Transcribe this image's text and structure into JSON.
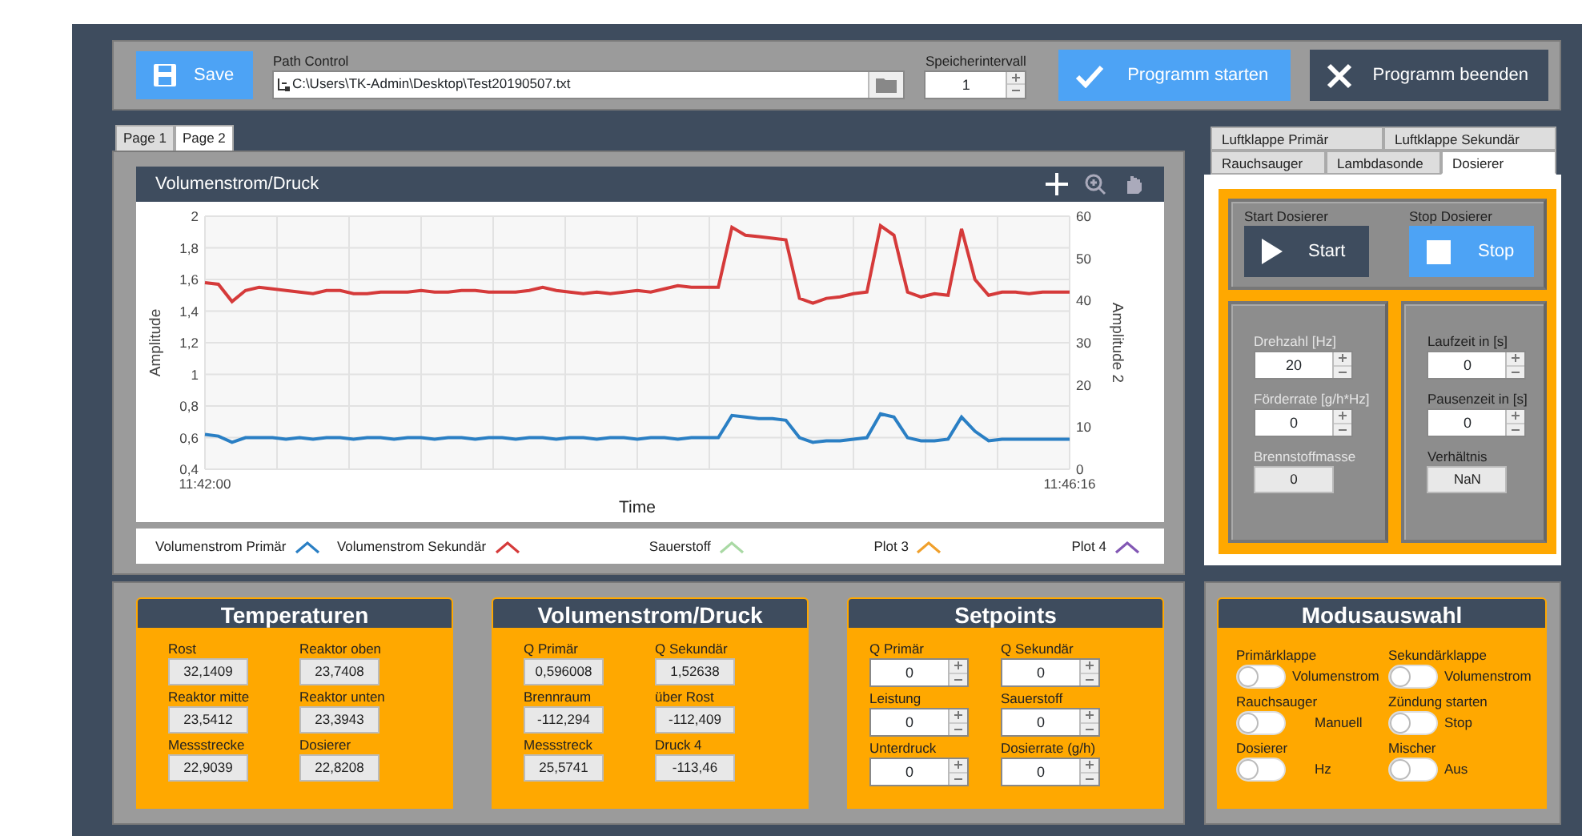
{
  "toolbar": {
    "save_button": "Save",
    "path_label": "Path Control",
    "path_value": "C:\\Users\\TK-Admin\\Desktop\\Test20190507.txt",
    "interval_label": "Speicherintervall",
    "interval_value": "1",
    "start_button": "Programm starten",
    "stop_button": "Programm beenden"
  },
  "page_tabs": [
    {
      "label": "Page 1",
      "selected": false
    },
    {
      "label": "Page 2",
      "selected": true
    }
  ],
  "chart": {
    "title": "Volumenstrom/Druck",
    "chart_data": {
      "type": "line",
      "grid": true,
      "xlabel": "Time",
      "ylabel": "Amplitude",
      "y2label": "Amplitude 2",
      "ylim": [
        0.4,
        2
      ],
      "y2lim": [
        0,
        60
      ],
      "yticks": [
        {
          "value": 0.4,
          "label": "0,4"
        },
        {
          "value": 0.6,
          "label": "0,6"
        },
        {
          "value": 0.8,
          "label": "0,8"
        },
        {
          "value": 1,
          "label": "1"
        },
        {
          "value": 1.2,
          "label": "1,2"
        },
        {
          "value": 1.4,
          "label": "1,4"
        },
        {
          "value": 1.6,
          "label": "1,6"
        },
        {
          "value": 1.8,
          "label": "1,8"
        },
        {
          "value": 2,
          "label": "2"
        }
      ],
      "y2ticks": [
        0,
        10,
        20,
        30,
        40,
        50,
        60
      ],
      "categories": [
        "11:42:00",
        null,
        null,
        null,
        null,
        null,
        null,
        null,
        null,
        null,
        null,
        null,
        null,
        null,
        null,
        null,
        null,
        null,
        null,
        null,
        null,
        null,
        null,
        null,
        null,
        null,
        null,
        null,
        null,
        null,
        null,
        null,
        null,
        null,
        null,
        null,
        null,
        null,
        null,
        null,
        null,
        null,
        null,
        null,
        null,
        null,
        null,
        null,
        null,
        null,
        null,
        null,
        null,
        null,
        null,
        null,
        null,
        null,
        null,
        null,
        null,
        null,
        null,
        null,
        "11:46:16"
      ],
      "series": [
        {
          "name": "Volumenstrom Primär",
          "color": "#2a7fc4",
          "values": [
            0.62,
            0.61,
            0.57,
            0.6,
            0.6,
            0.6,
            0.59,
            0.6,
            0.59,
            0.6,
            0.6,
            0.59,
            0.6,
            0.6,
            0.59,
            0.6,
            0.6,
            0.59,
            0.6,
            0.6,
            0.59,
            0.6,
            0.6,
            0.59,
            0.6,
            0.6,
            0.59,
            0.6,
            0.6,
            0.59,
            0.6,
            0.6,
            0.59,
            0.6,
            0.6,
            0.59,
            0.6,
            0.6,
            0.6,
            0.74,
            0.73,
            0.72,
            0.72,
            0.71,
            0.6,
            0.57,
            0.58,
            0.58,
            0.59,
            0.6,
            0.75,
            0.73,
            0.6,
            0.58,
            0.58,
            0.59,
            0.73,
            0.64,
            0.58,
            0.59,
            0.59,
            0.59,
            0.59,
            0.59,
            0.59
          ]
        },
        {
          "name": "Volumenstrom Sekundär",
          "color": "#d53a3a",
          "values": [
            1.58,
            1.57,
            1.46,
            1.53,
            1.55,
            1.54,
            1.53,
            1.52,
            1.51,
            1.53,
            1.53,
            1.51,
            1.51,
            1.52,
            1.52,
            1.52,
            1.53,
            1.52,
            1.52,
            1.53,
            1.53,
            1.52,
            1.52,
            1.52,
            1.53,
            1.55,
            1.53,
            1.52,
            1.51,
            1.52,
            1.51,
            1.52,
            1.53,
            1.52,
            1.54,
            1.56,
            1.55,
            1.55,
            1.55,
            1.93,
            1.88,
            1.87,
            1.86,
            1.85,
            1.48,
            1.45,
            1.48,
            1.49,
            1.51,
            1.52,
            1.94,
            1.88,
            1.52,
            1.49,
            1.51,
            1.5,
            1.92,
            1.6,
            1.5,
            1.52,
            1.52,
            1.51,
            1.52,
            1.52,
            1.52
          ]
        }
      ]
    },
    "legend": [
      {
        "label": "Sauerstoff",
        "color": "#a9d9a4"
      },
      {
        "label": "Plot 3",
        "color": "#f0a02c"
      },
      {
        "label": "Plot 4",
        "color": "#8257b4"
      }
    ]
  },
  "device_tabs": [
    [
      {
        "label": "Luftklappe Primär",
        "selected": false
      },
      {
        "label": "Luftklappe Sekundär",
        "selected": false
      }
    ],
    [
      {
        "label": "Rauchsauger",
        "selected": false
      },
      {
        "label": "Lambdasonde",
        "selected": false
      },
      {
        "label": "Dosierer",
        "selected": true
      }
    ]
  ],
  "dosierer": {
    "start_label": "Start Dosierer",
    "start_button": "Start",
    "stop_label": "Stop Dosierer",
    "stop_button": "Stop",
    "columns": [
      [
        {
          "label": "Drehzahl [Hz]",
          "value": "20",
          "kind": "control"
        },
        {
          "label": "Förderrate [g/h*Hz]",
          "value": "0",
          "kind": "control"
        },
        {
          "label": "Brennstoffmasse",
          "value": "0",
          "kind": "indicator"
        }
      ],
      [
        {
          "label": "Laufzeit in [s]",
          "value": "0",
          "kind": "control"
        },
        {
          "label": "Pausenzeit in [s]",
          "value": "0",
          "kind": "control"
        },
        {
          "label": "Verhältnis",
          "value": "NaN",
          "kind": "indicator"
        }
      ]
    ]
  },
  "groups": [
    {
      "title": "Temperaturen",
      "fields": [
        {
          "label": "Rost",
          "value": "32,1409",
          "kind": "indicator"
        },
        {
          "label": "Reaktor oben",
          "value": "23,7408",
          "kind": "indicator"
        },
        {
          "label": "Reaktor mitte",
          "value": "23,5412",
          "kind": "indicator"
        },
        {
          "label": "Reaktor unten",
          "value": "23,3943",
          "kind": "indicator"
        },
        {
          "label": "Messstrecke",
          "value": "22,9039",
          "kind": "indicator"
        },
        {
          "label": "Dosierer",
          "value": "22,8208",
          "kind": "indicator"
        }
      ]
    },
    {
      "title": "Volumenstrom/Druck",
      "fields": [
        {
          "label": "Q Primär",
          "value": "0,596008",
          "kind": "indicator"
        },
        {
          "label": "Q Sekundär",
          "value": "1,52638",
          "kind": "indicator"
        },
        {
          "label": "Brennraum",
          "value": "-112,294",
          "kind": "indicator"
        },
        {
          "label": "über Rost",
          "value": "-112,409",
          "kind": "indicator"
        },
        {
          "label": "Messstreck",
          "value": "25,5741",
          "kind": "indicator"
        },
        {
          "label": "Druck 4",
          "value": "-113,46",
          "kind": "indicator"
        }
      ]
    },
    {
      "title": "Setpoints",
      "fields": [
        {
          "label": "Q Primär",
          "value": "0",
          "kind": "control"
        },
        {
          "label": "Q Sekundär",
          "value": "0",
          "kind": "control"
        },
        {
          "label": "Leistung",
          "value": "0",
          "kind": "control"
        },
        {
          "label": "Sauerstoff",
          "value": "0",
          "kind": "control"
        },
        {
          "label": "Unterdruck",
          "value": "0",
          "kind": "control"
        },
        {
          "label": "Dosierrate (g/h)",
          "value": "0",
          "kind": "control"
        }
      ]
    }
  ],
  "mode": {
    "title": "Modusauswahl",
    "switches": [
      {
        "label": "Primärklappe",
        "state_text": "Volumenstrom",
        "on": false
      },
      {
        "label": "Sekundärklappe",
        "state_text": "Volumenstrom",
        "on": false
      },
      {
        "label": "Rauchsauger",
        "state_text": "Manuell",
        "on": false
      },
      {
        "label": "Zündung starten",
        "state_text": "Stop",
        "on": false
      },
      {
        "label": "Dosierer",
        "state_text": "Hz",
        "on": false
      },
      {
        "label": "Mischer",
        "state_text": "Aus",
        "on": false
      }
    ]
  }
}
